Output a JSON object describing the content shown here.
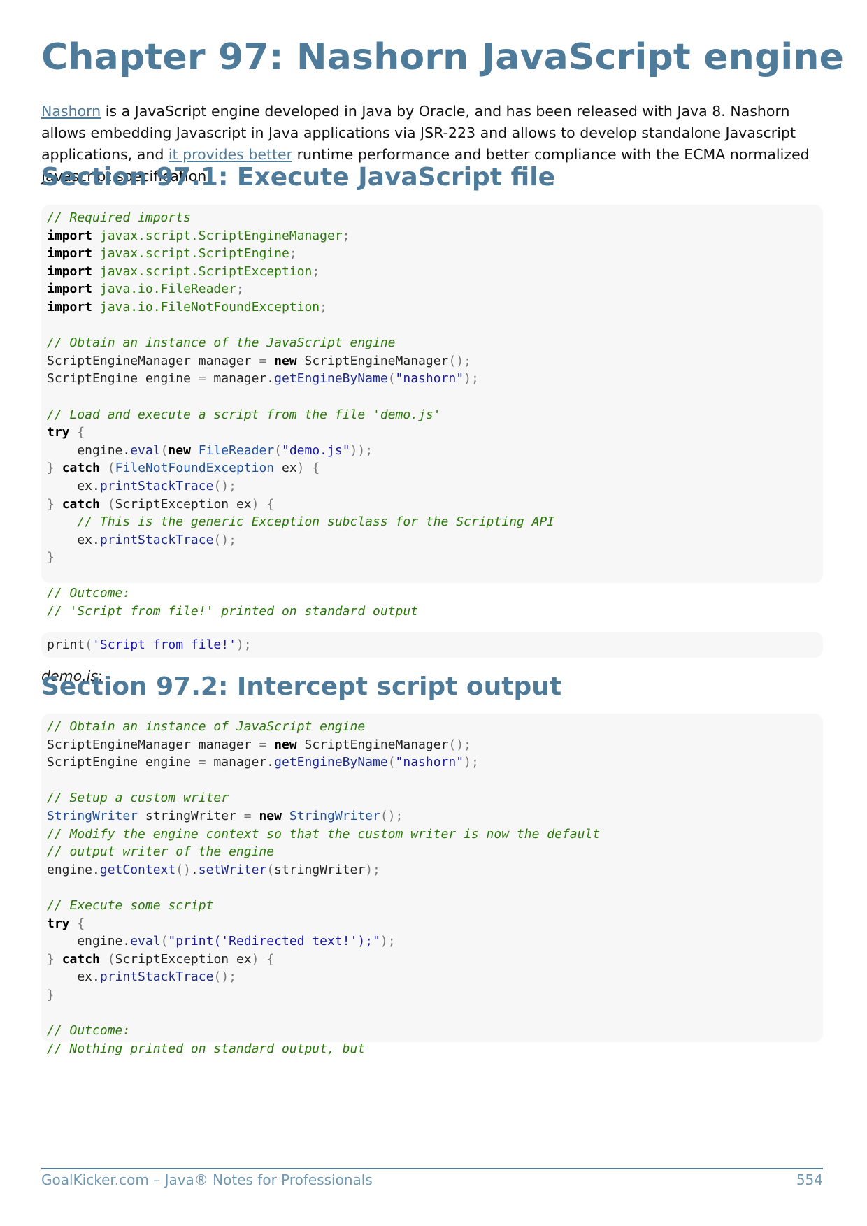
{
  "chapter": {
    "title": "Chapter 97: Nashorn JavaScript engine"
  },
  "intro": {
    "link1": "Nashorn",
    "text1": " is a JavaScript engine developed in Java by Oracle, and has been released with Java 8. Nashorn allows embedding Javascript in Java applications via JSR-223 and allows to develop standalone Javascript applications, and ",
    "link2": "it provides better",
    "text2": " runtime performance and better compliance with the ECMA normalized Javascript specification."
  },
  "sections": [
    {
      "title": "Section 97.1: Execute JavaScript file"
    },
    {
      "title": "Section 97.2: Intercept script output"
    }
  ],
  "demo_label": "demo.js",
  "demo_label_suffix": ":",
  "code1": [
    "// Required imports",
    "import javax.script.ScriptEngineManager;",
    "import javax.script.ScriptEngine;",
    "import javax.script.ScriptException;",
    "import java.io.FileReader;",
    "import java.io.FileNotFoundException;",
    "",
    "// Obtain an instance of the JavaScript engine",
    "ScriptEngineManager manager = new ScriptEngineManager();",
    "ScriptEngine engine = manager.getEngineByName(\"nashorn\");",
    "",
    "// Load and execute a script from the file 'demo.js'",
    "try {",
    "    engine.eval(new FileReader(\"demo.js\"));",
    "} catch (FileNotFoundException ex) {",
    "    ex.printStackTrace();",
    "} catch (ScriptException ex) {",
    "    // This is the generic Exception subclass for the Scripting API",
    "    ex.printStackTrace();",
    "}",
    "",
    "// Outcome:",
    "// 'Script from file!' printed on standard output"
  ],
  "code2": [
    "print('Script from file!');"
  ],
  "code3": [
    "// Obtain an instance of JavaScript engine",
    "ScriptEngineManager manager = new ScriptEngineManager();",
    "ScriptEngine engine = manager.getEngineByName(\"nashorn\");",
    "",
    "// Setup a custom writer",
    "StringWriter stringWriter = new StringWriter();",
    "// Modify the engine context so that the custom writer is now the default",
    "// output writer of the engine",
    "engine.getContext().setWriter(stringWriter);",
    "",
    "// Execute some script",
    "try {",
    "    engine.eval(\"print('Redirected text!');\");",
    "} catch (ScriptException ex) {",
    "    ex.printStackTrace();",
    "}",
    "",
    "// Outcome:",
    "// Nothing printed on standard output, but"
  ],
  "footer": {
    "left": "GoalKicker.com – Java® Notes for Professionals",
    "page": "554"
  }
}
